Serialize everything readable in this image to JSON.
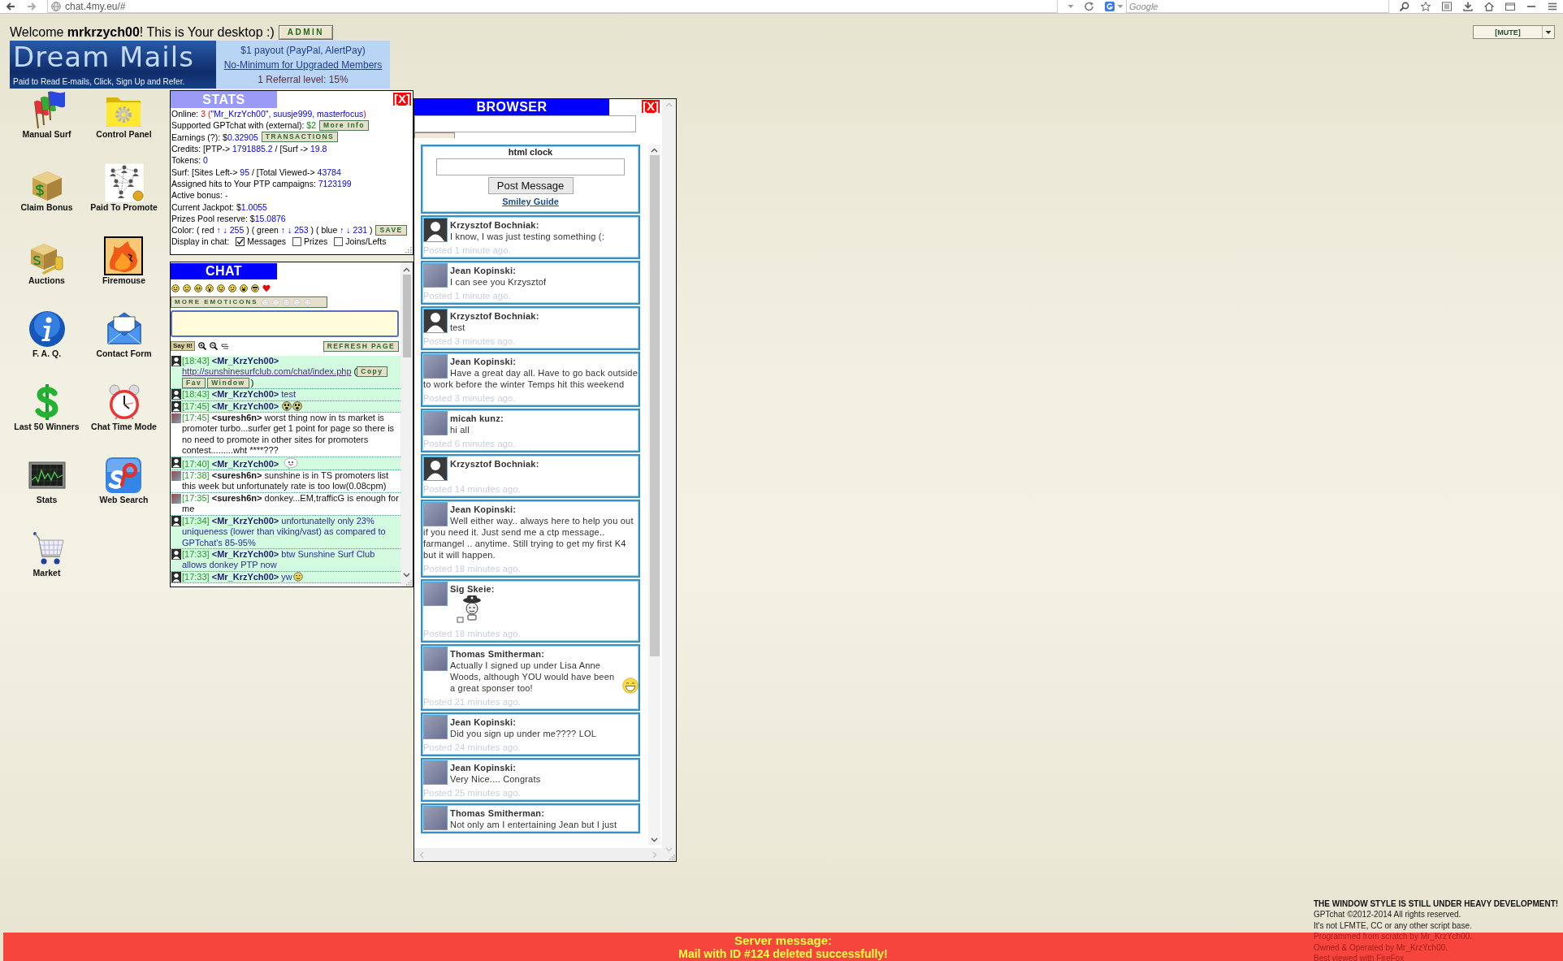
{
  "browser_toolbar": {
    "url": "chat.4my.eu/#",
    "search_placeholder": "Google"
  },
  "header": {
    "welcome": "Welcome **mrkrzych00**! This is Your desktop :)",
    "admin_button": "ADMIN",
    "mute_select": "[MUTE]"
  },
  "banner": {
    "logo": "Dream Mails",
    "tagline": "Paid to Read E-mails, Click, Sign Up and Refer.",
    "lines": [
      {
        "text": "$1 payout (PayPal, AlertPay)",
        "kind": "plain"
      },
      {
        "text": "No-Minimum for Upgraded Members",
        "kind": "link"
      },
      {
        "text": "1 Referral level: 15%",
        "kind": "note"
      }
    ]
  },
  "desktop_icons": [
    {
      "label": "Manual Surf"
    },
    {
      "label": "Control Panel"
    },
    {
      "label": "Claim Bonus"
    },
    {
      "label": "Paid To Promote"
    },
    {
      "label": "Auctions"
    },
    {
      "label": "Firemouse"
    },
    {
      "label": "F. A. Q."
    },
    {
      "label": "Contact Form"
    },
    {
      "label": "Last 50 Winners"
    },
    {
      "label": "Chat Time Mode"
    },
    {
      "label": "Stats"
    },
    {
      "label": "Web Search"
    },
    {
      "label": "Market"
    }
  ],
  "stats_window": {
    "title": "STATS",
    "close": "[X]",
    "lines": [
      {
        "parts": [
          {
            "text": "Online: ",
            "kind": "label"
          },
          {
            "text": "3 (",
            "kind": "alert"
          },
          {
            "text": "\"Mr_KrzYch00\", suusje999, masterfocus",
            "kind": "value"
          },
          {
            "text": ")",
            "kind": "alert"
          }
        ]
      },
      {
        "parts": [
          {
            "text": "Supported GPTchat with (external): ",
            "kind": "label"
          },
          {
            "text": "$2",
            "kind": "money"
          }
        ],
        "button": "More Info"
      },
      {
        "parts": [
          {
            "text": "Earnings (?): $",
            "kind": "label"
          },
          {
            "text": "0.32905",
            "kind": "value"
          }
        ],
        "button": "TRANSACTIONS"
      },
      {
        "parts": [
          {
            "text": "Credits: [PTP-> ",
            "kind": "label"
          },
          {
            "text": "1791885.2",
            "kind": "value"
          },
          {
            "text": " / [Surf -> ",
            "kind": "label"
          },
          {
            "text": "19.8",
            "kind": "value"
          }
        ]
      },
      {
        "parts": [
          {
            "text": "Tokens: ",
            "kind": "label"
          },
          {
            "text": "0",
            "kind": "value"
          }
        ]
      },
      {
        "parts": [
          {
            "text": "Surf: [Sites Left-> ",
            "kind": "label"
          },
          {
            "text": "95",
            "kind": "value"
          },
          {
            "text": " / [Total Viewed-> ",
            "kind": "label"
          },
          {
            "text": "43784",
            "kind": "value"
          }
        ]
      },
      {
        "parts": [
          {
            "text": "Assigned hits to Your PTP campaigns: ",
            "kind": "label"
          },
          {
            "text": "7123199",
            "kind": "value"
          }
        ]
      },
      {
        "parts": [
          {
            "text": "Active bonus: ",
            "kind": "label"
          },
          {
            "text": "-",
            "kind": "value"
          }
        ]
      },
      {
        "parts": [
          {
            "text": "Current Jackpot: $",
            "kind": "label"
          },
          {
            "text": "1.0055",
            "kind": "value"
          }
        ]
      },
      {
        "parts": [
          {
            "text": "Prizes Pool reserve: $",
            "kind": "label"
          },
          {
            "text": "15.0876",
            "kind": "value"
          }
        ]
      },
      {
        "parts": [
          {
            "text": "Color: ( red ",
            "kind": "label"
          },
          {
            "text": "↑ ↓ 255",
            "kind": "value"
          },
          {
            "text": " ) ( green ",
            "kind": "label"
          },
          {
            "text": "↑ ↓ 253",
            "kind": "value"
          },
          {
            "text": " ) ( blue ",
            "kind": "label"
          },
          {
            "text": "↑ ↓ 231",
            "kind": "value"
          },
          {
            "text": " )",
            "kind": "label"
          }
        ],
        "button": "SAVE"
      }
    ],
    "display_in_chat": {
      "label": "Display in chat:",
      "options": [
        {
          "label": "Messages",
          "checked": true
        },
        {
          "label": "Prizes",
          "checked": false
        },
        {
          "label": "Joins/Lefts",
          "checked": false
        }
      ]
    }
  },
  "chat_window": {
    "title": "CHAT",
    "more_emoticons_button": "MORE EMOTICONS",
    "say_button": "Say It!",
    "refresh_button": "REFRESH PAGE",
    "messages": [
      {
        "time": "[18:43]",
        "nick": "<Mr_KrzYch00>",
        "text": "http://sunshinesurfclub.com/chat/index.php",
        "kind": "link",
        "highlighted": true,
        "avatar": {
          "kind": "silhouette"
        },
        "open": "(",
        "actions": [
          "Copy",
          "Fav",
          "Window"
        ],
        "close": ")"
      },
      {
        "time": "[18:43]",
        "nick": "<Mr_KrzYch00>",
        "text": "test",
        "kind": "text",
        "highlighted": true,
        "avatar": {
          "kind": "silhouette"
        }
      },
      {
        "time": "[17:45]",
        "nick": "<Mr_KrzYch00>",
        "kind": "faces",
        "highlighted": true,
        "avatar": {
          "kind": "silhouette"
        }
      },
      {
        "time": "[17:45]",
        "nick": "<suresh6n>",
        "text": "worst thing now in ts market is promoter turbo...surfer get 1 point for page so there is no need to promote in other sites for promoters contest.........wht ****???",
        "kind": "text",
        "highlighted": false,
        "avatar": {
          "kind": "photo"
        }
      },
      {
        "time": "[17:40]",
        "nick": "<Mr_KrzYch00>",
        "kind": "bubble",
        "highlighted": true,
        "avatar": {
          "kind": "silhouette"
        }
      },
      {
        "time": "[17:38]",
        "nick": "<suresh6n>",
        "text": "sunshine is in TS promoters list this week but unfortunately rate is too low(0.08cpm)",
        "kind": "text",
        "highlighted": false,
        "avatar": {
          "kind": "photo"
        }
      },
      {
        "time": "[17:35]",
        "nick": "<suresh6n>",
        "text": "donkey...EM,trafficG is enough for me",
        "kind": "text",
        "highlighted": false,
        "avatar": {
          "kind": "photo"
        }
      },
      {
        "time": "[17:34]",
        "nick": "<Mr_KrzYch00>",
        "text": "unfortunatelly only 23% uniqueness (lower than viking/vast) as compared to GPTchat's 85-95%",
        "kind": "text",
        "highlighted": true,
        "avatar": {
          "kind": "silhouette"
        }
      },
      {
        "time": "[17:33]",
        "nick": "<Mr_KrzYch00>",
        "text": "btw Sunshine Surf Club allows donkey PTP now",
        "kind": "text",
        "highlighted": true,
        "avatar": {
          "kind": "silhouette"
        }
      },
      {
        "time": "[17:33]",
        "nick": "<Mr_KrzYch00>",
        "text": "yw",
        "kind": "smiley",
        "highlighted": true,
        "avatar": {
          "kind": "silhouette"
        }
      }
    ]
  },
  "browser_window": {
    "title": "BROWSER",
    "close": "[X]",
    "clock_form": {
      "title": "html clock",
      "post_button": "Post Message",
      "smiley_link": "Smiley Guide"
    },
    "posts": [
      {
        "author": "Krzysztof Bochniak:",
        "text": "I know, I was just testing something (:",
        "posted": "Posted 1 minute ago.",
        "avatar": {
          "kind": "silhouette"
        },
        "kind": "text"
      },
      {
        "author": "Jean Kopinski:",
        "text": "I can see you Krzysztof",
        "posted": "Posted 1 minute ago.",
        "avatar": {
          "kind": "photo"
        },
        "kind": "text"
      },
      {
        "author": "Krzysztof Bochniak:",
        "text": "test",
        "posted": "Posted 3 minutes ago.",
        "avatar": {
          "kind": "silhouette"
        },
        "kind": "text"
      },
      {
        "author": "Jean Kopinski:",
        "text": "Have a great day all. Have to go back outside to work before the winter Temps hit this weekend",
        "posted": "Posted 3 minutes ago.",
        "avatar": {
          "kind": "photo"
        },
        "kind": "text"
      },
      {
        "author": "micah kunz:",
        "text": "hi all",
        "posted": "Posted 6 minutes ago.",
        "avatar": {
          "kind": "photo"
        },
        "kind": "text"
      },
      {
        "author": "Krzysztof Bochniak:",
        "posted": "Posted 14 minutes ago.",
        "avatar": {
          "kind": "silhouette"
        },
        "kind": "blank"
      },
      {
        "author": "Jean Kopinski:",
        "text": "Well either way.. always here to help you out if you need it. Just send me a ctp message.. farmangel .. anytime. Still trying to get my first K4 but it will happen.",
        "posted": "Posted 18 minutes ago.",
        "avatar": {
          "kind": "photo"
        },
        "kind": "text"
      },
      {
        "author": "Sig Skeie:",
        "posted": "Posted 18 minutes ago.",
        "avatar": {
          "kind": "photo"
        },
        "kind": "sticker"
      },
      {
        "author": "Thomas Smitherman:",
        "text": "Actually I signed up under Lisa Anne Woods, although YOU would have been a great sponser too!",
        "posted": "Posted 21 minutes ago.",
        "avatar": {
          "kind": "photo"
        },
        "kind": "smiley"
      },
      {
        "author": "Jean Kopinski:",
        "text": "Did you sign up under me???? LOL",
        "posted": "Posted 24 minutes ago.",
        "avatar": {
          "kind": "photo"
        },
        "kind": "text"
      },
      {
        "author": "Jean Kopinski:",
        "text": "Very Nice.... Congrats",
        "posted": "Posted 25 minutes ago.",
        "avatar": {
          "kind": "photo"
        },
        "kind": "text"
      },
      {
        "author": "Thomas Smitherman:",
        "text": "Not only am I entertaining Jean but I just",
        "avatar": {
          "kind": "photo"
        },
        "kind": "text"
      }
    ]
  },
  "footer": {
    "lines": [
      {
        "text": "THE WINDOW STYLE IS STILL UNDER HEAVY DEVELOPMENT!",
        "kind": "notice"
      },
      {
        "text": "GPTchat ©2012-2014 All rights reserved.",
        "kind": "plain"
      },
      {
        "text": "It's not LFMTE, CC or any other script base.",
        "kind": "plain"
      },
      {
        "text": "Programmed from scratch by Mr_KrzYch00.",
        "kind": "credit"
      },
      {
        "text": "Owned & Operated by Mr_KrzYch00.",
        "kind": "credit"
      },
      {
        "text": "Best viewed with FireFox",
        "kind": "credit"
      }
    ]
  },
  "server_message": {
    "title": "Server message:",
    "text": "Mail with ID #124 deleted successfully!"
  }
}
